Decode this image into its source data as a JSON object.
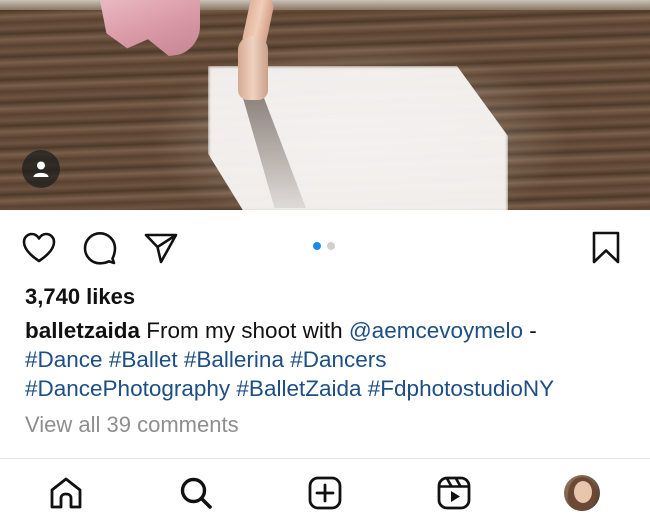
{
  "post": {
    "likes": "3,740 likes",
    "caption": {
      "username": "balletzaida",
      "text": " From my shoot with ",
      "mention": "@aemcevoymelo",
      "dash": " -",
      "hashtags_line1": [
        "#Dance",
        "#Ballet",
        "#Ballerina",
        "#Dancers"
      ],
      "hashtags_line2": [
        "#DancePhotography",
        "#BalletZaida",
        "#FdphotostudioNY"
      ]
    },
    "view_comments": "View all 39 comments",
    "carousel": {
      "total": 2,
      "active": 1
    }
  },
  "icons": {
    "tag": "person-icon",
    "like": "heart-icon",
    "comment": "comment-icon",
    "share": "send-icon",
    "save": "bookmark-icon"
  },
  "nav": [
    {
      "name": "home-icon"
    },
    {
      "name": "search-icon"
    },
    {
      "name": "create-icon"
    },
    {
      "name": "reels-icon"
    },
    {
      "name": "profile-avatar"
    }
  ],
  "colors": {
    "link": "#1d4e86",
    "dot_active": "#1a8ce8",
    "dot_inactive": "#d0d0d0",
    "muted": "#8e8e8e"
  }
}
